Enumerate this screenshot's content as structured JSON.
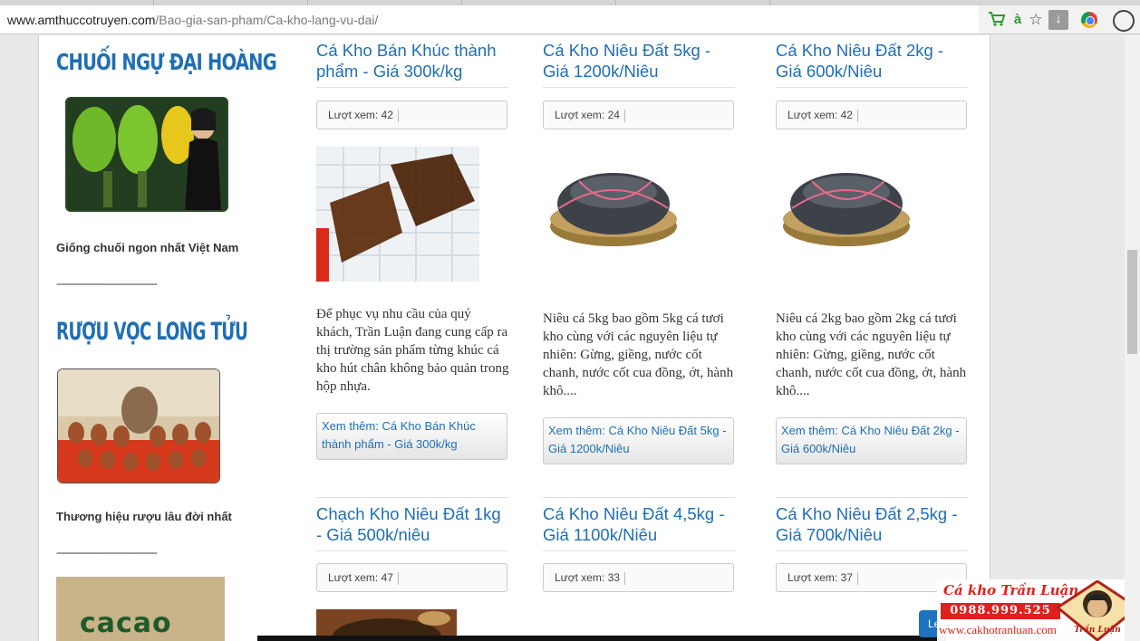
{
  "browser": {
    "url_host": "www.amthuccotruyen.com",
    "url_path": "/Bao-gia-san-pham/Ca-kho-lang-vu-dai/",
    "icons": [
      "cart-icon",
      "translate-icon",
      "star-icon",
      "download-icon",
      "chrome-icon",
      "menu-circle-icon"
    ],
    "translate_glyph": "à"
  },
  "sidebar": {
    "ad1": {
      "title": "CHUỐI NGỰ ĐẠI HOÀNG",
      "caption": "Giống chuối ngon nhất Việt Nam"
    },
    "divider": "-------------------------------------",
    "ad2": {
      "title": "RƯỢU VỌC LONG TỬU",
      "caption": "Thương hiệu rượu lâu đời nhất"
    },
    "ad3": {
      "logo_text": "cacao"
    }
  },
  "products": [
    {
      "title": "Cá Kho Bán Khúc thành phẩm - Giá 300k/kg",
      "views": "Lượt xem: 42",
      "description": "Để phục vụ nhu cầu của quý khách, Trần Luận đang cung cấp ra thị trường sản phẩm từng khúc cá kho hút chân không bảo quản trong hộp nhựa.",
      "more": "Xem thêm: Cá Kho Bán Khúc thành phẩm - Giá 300k/kg"
    },
    {
      "title": "Cá Kho Niêu Đất 5kg - Giá 1200k/Niêu",
      "views": "Lượt xem: 24",
      "description": "Niêu cá 5kg bao gồm 5kg cá tươi kho cùng với các nguyên liệu tự nhiên: Gừng, giềng, nước cốt chanh, nước cốt cua đồng, ớt, hành khô....",
      "more": "Xem thêm: Cá Kho Niêu Đất 5kg - Giá 1200k/Niêu"
    },
    {
      "title": "Cá Kho Niêu Đất 2kg - Giá 600k/Niêu",
      "views": "Lượt xem: 42",
      "description": "Niêu cá 2kg bao gồm 2kg cá tươi kho cùng với các nguyên liệu tự nhiên: Gừng, giềng, nước cốt chanh, nước cốt cua đồng, ớt, hành khô....",
      "more": "Xem thêm: Cá Kho Niêu Đất 2kg - Giá 600k/Niêu"
    },
    {
      "title": "Chạch Kho Niêu Đất 1kg - Giá 500k/niêu",
      "views": "Lượt xem: 47"
    },
    {
      "title": "Cá Kho Niêu Đất 4,5kg - Giá 1100k/Niêu",
      "views": "Lượt xem: 33"
    },
    {
      "title": "Cá Kho Niêu Đất 2,5kg - Giá 700k/Niêu",
      "views": "Lượt xem: 37"
    }
  ],
  "floating_ad": {
    "title": "Cá kho Trần Luận",
    "phone": "0988.999.525",
    "site": "www.cakhotranluan.com",
    "badge_text": "Trần Luận",
    "button_label": "Le"
  },
  "colors": {
    "link_blue": "#1f6fb4",
    "ad_red": "#e0211b",
    "cart_green": "#2e9b32"
  }
}
